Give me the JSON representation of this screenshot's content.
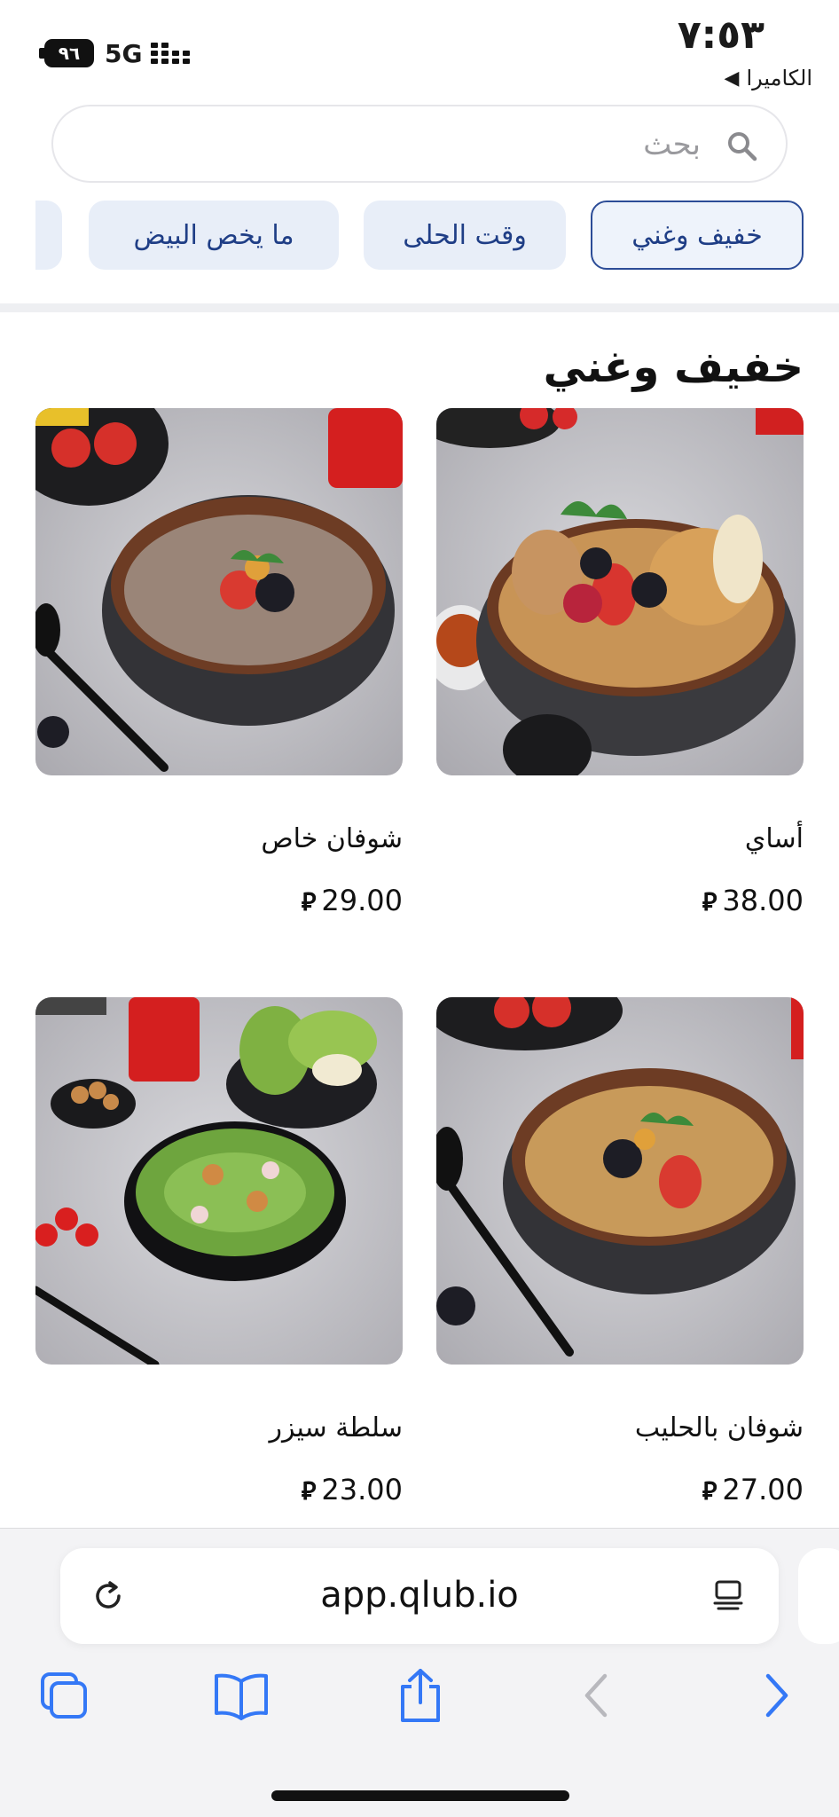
{
  "status_bar": {
    "time": "٧:٥٣",
    "back_label": "الكاميرا",
    "battery": "٩٦",
    "network": "5G"
  },
  "search": {
    "placeholder": "بحث",
    "value": ""
  },
  "categories": [
    {
      "label": "خفيف وغني",
      "active": true
    },
    {
      "label": "وقت الحلى",
      "active": false
    },
    {
      "label": "ما يخص البيض",
      "active": false
    }
  ],
  "section": {
    "title": "خفيف وغني"
  },
  "currency_symbol": "⃁",
  "products": [
    {
      "name": "أساي",
      "price": "38.00",
      "image": "acai-bowl"
    },
    {
      "name": "شوفان خاص",
      "price": "29.00",
      "image": "special-oats-bowl"
    },
    {
      "name": "شوفان بالحليب",
      "price": "27.00",
      "image": "milk-oats-bowl"
    },
    {
      "name": "سلطة سيزر",
      "price": "23.00",
      "image": "caesar-salad-bowl"
    }
  ],
  "browser": {
    "url": "app.qlub.io",
    "icons": [
      "reload-icon",
      "reader-mode-icon",
      "tabs-icon",
      "bookmarks-icon",
      "share-icon",
      "back-icon",
      "forward-icon"
    ]
  },
  "colors": {
    "accent": "#2c4c97",
    "chip_bg": "#e8eef8",
    "ios_blue": "#3478f6"
  }
}
